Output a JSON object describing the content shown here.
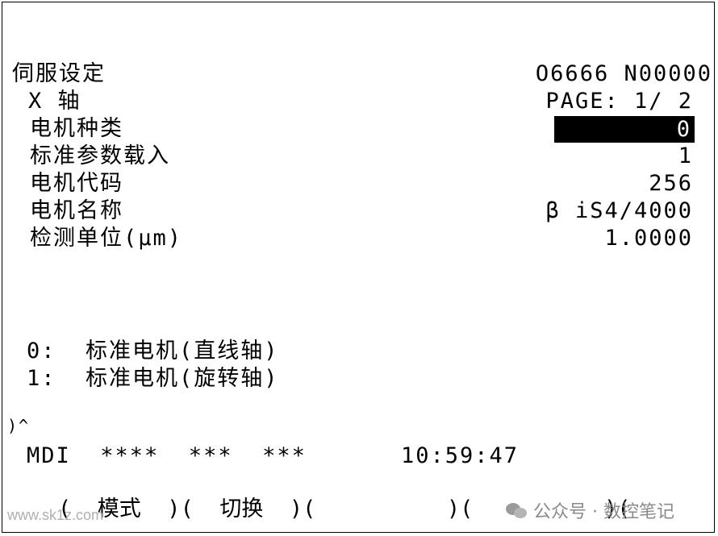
{
  "header": {
    "title": "伺服设定",
    "program": "O6666 N00000",
    "axis": "X 轴",
    "page": "PAGE: 1/ 2"
  },
  "params": [
    {
      "label": "电机种类",
      "value": "0",
      "selected": true
    },
    {
      "label": "标准参数载入",
      "value": "1"
    },
    {
      "label": "电机代码",
      "value": "256"
    },
    {
      "label": "电机名称",
      "value": "β iS4/4000"
    },
    {
      "label": "检测单位(μm)",
      "value": "1.0000"
    }
  ],
  "help": [
    "0:  标准电机(直线轴)",
    "1:  标准电机(旋转轴)"
  ],
  "input_prompt": ")^",
  "status": {
    "mode": "MDI  ****  ***  ***",
    "time": "10:59:47"
  },
  "softkeys": {
    "line": "(  模式  )(  切换  )(          )(          )(          )",
    "keys": [
      "模式",
      "切换",
      "",
      "",
      ""
    ]
  },
  "watermark": {
    "url": "www.sk1z.com",
    "account": "公众号 · 数控笔记"
  }
}
